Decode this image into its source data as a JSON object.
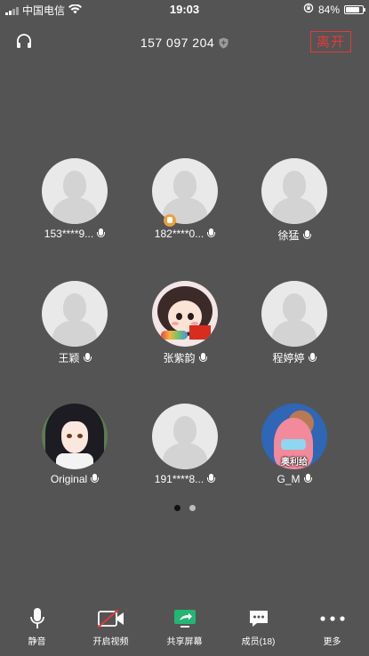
{
  "status_bar": {
    "carrier": "中国电信",
    "time": "19:03",
    "battery": "84%",
    "battery_level": 0.84
  },
  "header": {
    "meeting_id": "157 097 204",
    "leave_label": "离开"
  },
  "participants": [
    {
      "name": "153****9..."
    },
    {
      "name": "182****0..."
    },
    {
      "name": "徐猛"
    },
    {
      "name": "王颖"
    },
    {
      "name": "张紫韵"
    },
    {
      "name": "程婷婷"
    },
    {
      "name": "Original"
    },
    {
      "name": "191****8..."
    },
    {
      "name": "G_M",
      "avatar_text": "奥利给"
    }
  ],
  "pagination": {
    "current_page": 1,
    "total_pages": 2
  },
  "toolbar": {
    "mute": "静音",
    "video": "开启视频",
    "share": "共享屏幕",
    "members": "成员(18)",
    "more": "更多"
  },
  "colors": {
    "background": "#545454",
    "leave": "#e33a3a",
    "share_icon": "#22b573",
    "host_badge": "#e8a13a"
  },
  "icons": [
    "signal-icon",
    "wifi-icon",
    "orientation-lock-icon",
    "battery-icon",
    "headset-icon",
    "shield-icon",
    "mic-icon",
    "crossed-video-icon",
    "share-screen-icon",
    "chat-members-icon",
    "more-icon",
    "host-crown-icon"
  ]
}
